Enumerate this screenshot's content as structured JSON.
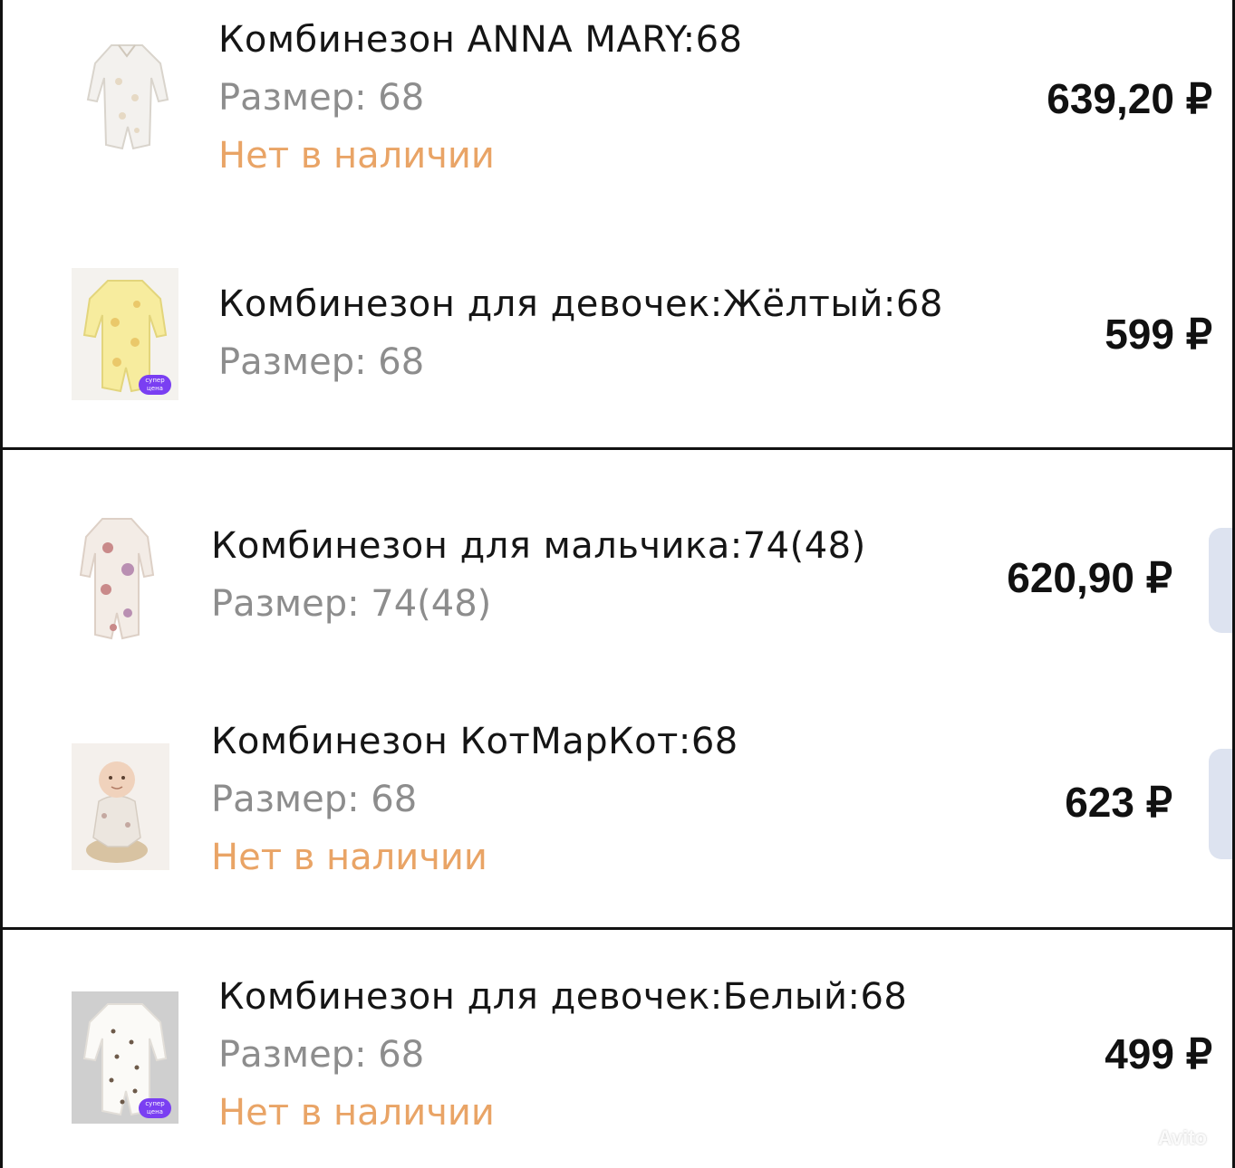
{
  "items": [
    {
      "name": "Комбинезон ANNA MARY:68",
      "size": "Размер: 68",
      "stock": "Нет в наличии",
      "price": "639,20 ₽",
      "image": "white-romper-image"
    },
    {
      "name": "Комбинезон для девочек:Жёлтый:68",
      "size": "Размер: 68",
      "price": "599 ₽",
      "image": "yellow-romper-image",
      "badge": "супер цена"
    },
    {
      "name": "Комбинезон для мальчика:74(48)",
      "size": "Размер: 74(48)",
      "price": "620,90 ₽",
      "image": "floral-romper-image"
    },
    {
      "name": "Комбинезон КотМарКот:68",
      "size": "Размер: 68",
      "stock": "Нет в наличии",
      "price": "623 ₽",
      "image": "baby-photo-image"
    },
    {
      "name": "Комбинезон для девочек:Белый:68",
      "size": "Размер: 68",
      "stock": "Нет в наличии",
      "price": "499 ₽",
      "image": "dotted-romper-image",
      "badge": "супер цена"
    }
  ],
  "watermark": "Avito",
  "colors": {
    "stock": "#e9a466",
    "size": "#8d8d8d",
    "badge": "#7a3ff2"
  }
}
